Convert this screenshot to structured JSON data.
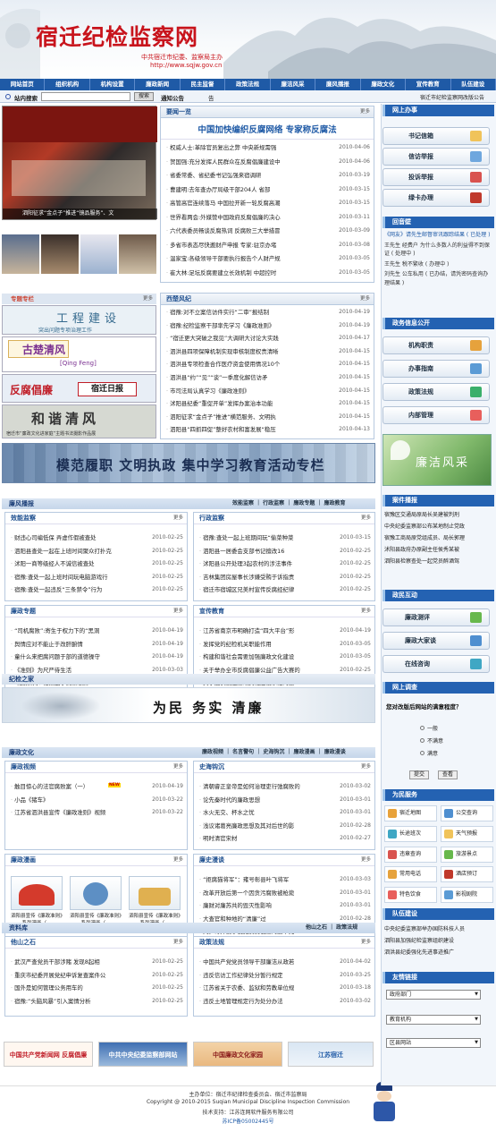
{
  "header": {
    "title": "宿迁纪检监察网",
    "subtitle": "中共宿迁市纪委、监察局主办",
    "url": "http://www.sqjw.gov.cn"
  },
  "nav": [
    "网站首页",
    "组织机构",
    "机构设置",
    "廉政新闻",
    "民主监督",
    "政策法规",
    "廉洁风采",
    "廉风播报",
    "廉政文化",
    "宣传教育",
    "队伍建设"
  ],
  "searchbar": {
    "label": "站内搜索",
    "button": "搜索",
    "notice_label": "通知公告",
    "notice_text": "告",
    "right_text": "宿迁市纪检监察网改版公告"
  },
  "photo_caption": "泗阳征求“金点子”推进“镜品服务”、文",
  "news": {
    "title": "要闻一览",
    "more": "更多",
    "headline": "中国加快编织反腐网络 专家称反腐法",
    "items": [
      [
        "权威人士:革除官员复出之弊 中央新规需强",
        "2010-04-06"
      ],
      [
        "贺国强:充分发挥人民群众在反腐倡廉建设中",
        "2010-04-06"
      ],
      [
        "省委常委、省纪委书记弘强来宿调研",
        "2010-03-19"
      ],
      [
        "曹建明:去年查办厅局级干部204人 省部",
        "2010-03-15"
      ],
      [
        "高管高官连续落马 中国拉开新一轮反腐高潮",
        "2010-03-15"
      ],
      [
        "世界看两会:外媒赞中国政府反腐倡廉的决心",
        "2010-03-11"
      ],
      [
        "六代表委员畅谈反腐热词 反腐败三大举措冒",
        "2010-03-09"
      ],
      [
        "多省市表态尽快邀财产申报 专家:驻京办堵",
        "2010-03-08"
      ],
      [
        "温家宝:各级领导干部要执行报告个人财产规",
        "2010-03-05"
      ],
      [
        "崔大林:足坛反腐要建立长效机制 中超控时",
        "2010-03-05"
      ]
    ]
  },
  "xichu": {
    "title": "西楚风纪",
    "more": "更多",
    "items": [
      [
        "宿豫:对不立案信访件实行“二审”报结制",
        "2010-04-19"
      ],
      [
        "宿豫:纪检监察干部率先学习《廉政准则》",
        "2010-04-19"
      ],
      [
        "“宿迁更大突破之我见”大调研大讨论大实践",
        "2010-04-17"
      ],
      [
        "泗洪县四项保障机制实现审核制度权责清晰",
        "2010-04-15"
      ],
      [
        "泗洪县专项检查合作医疗资金使用情况10个",
        "2010-04-15"
      ],
      [
        "泗洪县“约”“见”“谈”一季度化解信访矛",
        "2010-04-15"
      ],
      [
        "市司法局认真学习《廉政准则》",
        "2010-04-15"
      ],
      [
        "沭阳县纪委“重促开单”发挥办案治本功能",
        "2010-04-15"
      ],
      [
        "泗阳征求“金点子”推进“横范服务、文明执",
        "2010-04-15"
      ],
      [
        "泗阳县“四抓四促”整好农村和富发展“稳压",
        "2010-04-13"
      ]
    ]
  },
  "left_banners": {
    "mods_title": "专题专栏",
    "more": "更多",
    "b1": "工程建设",
    "b1s": "突出问题专项治理工作",
    "b2": "古楚清风",
    "b2s": "[Qing Feng]",
    "b3": "反腐倡廉",
    "b3s": "宿迁日报",
    "b4": "和谐清风",
    "b4s": "宿迁市“廉政文化进家庭”主题书法摄影作品展"
  },
  "wide_banner": "模范履职 文明执政 集中学习教育活动专栏",
  "lianfeng": {
    "title": "廉风播报",
    "tabs": "效能监察 ｜ 行政监察 ｜ 廉政专题 ｜ 廉政教育",
    "xiaoneng": {
      "title": "效能监察",
      "more": "更多",
      "items": [
        [
          "财违心司编低保 弄虚作假被查处",
          "2010-02-25"
        ],
        [
          "泗阳县查处一起在上班时间聚众打扑克",
          "2010-02-25"
        ],
        [
          "沭阳一商等级经人不诚信被查处",
          "2010-02-25"
        ],
        [
          "宿豫:查处一起上班时间玩电脑游戏行",
          "2010-02-25"
        ],
        [
          "宿豫:查处一起违反“三条禁令”行为",
          "2010-02-25"
        ]
      ]
    },
    "xingzheng": {
      "title": "行政监察",
      "more": "更多",
      "items": [
        [
          "宿豫:查处一起上班期间玩“偷菜种菜",
          "2010-03-15"
        ],
        [
          "泗阳县一居委会支部书记擅改16",
          "2010-02-25"
        ],
        [
          "沭阳县公开处理3起农村的涉法事件",
          "2010-02-25"
        ],
        [
          "吉林集团房屋事长涉嫌受贿于诉指责",
          "2010-02-25"
        ],
        [
          "宿迁市宿城区兄美村宣传反腐经纪律",
          "2010-02-25"
        ]
      ]
    },
    "lianzheng": {
      "title": "廉政专题",
      "more": "更多",
      "items": [
        [
          "“司机腐败”:寄生于权力下的“黑洞",
          "2010-04-19"
        ],
        [
          "舆情应对不能止于改肝腑情",
          "2010-04-19"
        ],
        [
          "童什么来把腐问题于部的道德操守",
          "2010-04-19"
        ],
        [
          "《准则》为尺严待生活",
          "2010-03-03"
        ],
        [
          "“红顾娟水”论捕盖了腐败根源",
          "2010-03-03"
        ]
      ]
    },
    "xuanchuan": {
      "title": "宣传教育",
      "more": "更多",
      "items": [
        [
          "江苏省南京市明确打造“四大平台”形",
          "2010-04-19"
        ],
        [
          "发挥党的纪检机关职能作用",
          "2010-03-05"
        ],
        [
          "构建和谐社会需要加强廉政文化建设",
          "2010-03-05"
        ],
        [
          "关于举办全市反腐倡廉公益广告大赛的",
          "2010-02-25"
        ],
        [
          "关于加快创建廉政文化建设示范的通",
          "2010-02-25"
        ]
      ]
    }
  },
  "jifeng": {
    "title": "纪检之家"
  },
  "slogan": "为民 务实 清廉",
  "wenhua": {
    "title": "廉政文化",
    "tabs": "廉政视频 ｜ 名言警句 ｜ 史海钩沉 ｜ 廉政漫画 ｜ 廉政漫谈",
    "video": {
      "title": "廉政视频",
      "more": "更多",
      "items": [
        [
          "触目惊心的法官腐败案（一）",
          "2010-04-19"
        ],
        [
          "小品《猪车》",
          "2010-03-22"
        ],
        [
          "江苏省泗洪县宣传《廉政准则》视频",
          "2010-03-22"
        ]
      ],
      "new": "NEW"
    },
    "shihai": {
      "title": "史海钩沉",
      "more": "更多",
      "items": [
        [
          "清朝睿正皇帝是如何治理吏行弛腐败的",
          "2010-03-02"
        ],
        [
          "论先秦时代的廉政思想",
          "2010-03-01"
        ],
        [
          "水火无交、杯水之忧",
          "2010-03-01"
        ],
        [
          "浅议诸葛亮廉政思想及其对后世的影",
          "2010-02-28"
        ],
        [
          "明时清官宋材",
          "2010-02-27"
        ]
      ]
    },
    "manhua": {
      "title": "廉政漫画",
      "more": "更多",
      "captions": [
        "泗阳县宣传《廉政准则》系列漫画（…",
        "泗阳县宣传《廉政准则》系列漫画（…",
        "泗阳县宣传《廉政准则》系列漫画（…"
      ]
    },
    "lishi": {
      "title": "廉史漫谈",
      "more": "更多",
      "items": [
        [
          "“拒腐猫将军”：雍号彰县叶飞将军",
          "2010-03-03"
        ],
        [
          "改革开放后第一个因贪污腐败被枪毙",
          "2010-03-01"
        ],
        [
          "廉财对廉苏共的毁灭性影响",
          "2010-03-01"
        ],
        [
          "大查官和种地的“清廉”过",
          "2010-02-28"
        ],
        [
          "刘少奇开创了我党反腐倡廉的最早先",
          "2010-02-27"
        ]
      ]
    }
  },
  "ziliao": {
    "title": "资料库",
    "tabs": "他山之石 ｜ 政策法规",
    "tashan": {
      "title": "他山之石",
      "more": "更多",
      "items": [
        [
          "武汉严查党员干部涉赌 发现8起相",
          "2010-02-25"
        ],
        [
          "重庆市纪委开展党纪申诉复查案件公",
          "2010-02-25"
        ],
        [
          "国外是如何管理公务用车的",
          "2010-02-25"
        ],
        [
          "宿豫:“头脑风暴”引入案情分析",
          "2010-02-25"
        ]
      ]
    },
    "fagui": {
      "title": "政策法规",
      "more": "更多",
      "items": [
        [
          "中国共产党党员领导干部廉洁从政若",
          "2010-04-02"
        ],
        [
          "违反信访工作纪律处分暂行规定",
          "2010-03-25"
        ],
        [
          "江苏省关于农委、监狱和劳教单位规",
          "2010-03-18"
        ],
        [
          "违反土地管理规定行为处分办法",
          "2010-03-02"
        ]
      ]
    }
  },
  "footer_logos": [
    "中国共产党新闻网 反腐倡廉",
    "中共中央纪委监察部网站",
    "中国廉政文化家园",
    "江苏宿迁"
  ],
  "footer": {
    "l1": "主办单位：宿迁市纪律检查委员会、宿迁市监察局",
    "l2": "Copyright @ 2010-2015 Suqian Municipal Discipline Inspection Commission",
    "l3": "技术支持：江苏连网软件服务有限公司",
    "l4": "苏ICP备05002445号"
  },
  "right": {
    "banshi": {
      "title": "网上办事",
      "buttons": [
        "书记信箱",
        "信访举报",
        "投诉举报",
        "绿卡办理"
      ]
    },
    "huiyin": {
      "title": "回音壁",
      "items": [
        "《网友》请先生邮督审讯跟踪结果 ( 已处理 )",
        "王先生 经费户 为什么多数人的利益得不到保证 ( 处理中 )",
        "王先生 税不繁收 ( 办理中 )",
        "刘先生 公车私用 ( 已办结，请凭密码查询办理结果 )"
      ]
    },
    "zhengwu": {
      "title": "政务信息公开",
      "buttons": [
        "机构职责",
        "办事指南",
        "政策法规",
        "内部管理"
      ]
    },
    "fengcai": "廉洁风采",
    "anjian": {
      "title": "案件播报",
      "items": [
        "宿豫区交通局原局长吴建被判刑",
        "中央纪委监察部公布某地制止党政",
        "宿豫工商局原党组成员、局长郭理",
        "沭阳县政府办原副主任侯秀某被",
        "泗阳县检察查处一起党员醉酒驾"
      ]
    },
    "hudong": {
      "title": "政民互动",
      "buttons": [
        "廉政测评",
        "廉政大家谈",
        "在线咨询"
      ]
    },
    "diaocha": {
      "title": "网上调查",
      "question": "您对改版后网站的满意程度？",
      "options": [
        "一般",
        "不满意",
        "满意"
      ],
      "submit": "提交",
      "view": "查看"
    },
    "fuwu": {
      "title": "为民服务",
      "items": [
        "宿迁地图",
        "公交查询",
        "长途班次",
        "天气预报",
        "违章查询",
        "旅游景点",
        "常用电话",
        "酒店预订",
        "特色饮食",
        "影视剧院"
      ]
    },
    "duiwu": {
      "title": "队伍建设",
      "items": [
        "中央纪委监察部举办国防科技人员",
        "泗阳县加强纪检监察组织建设",
        "泗洪县纪委强化先进事迹推广"
      ]
    },
    "links": {
      "title": "友情链接",
      "selects": [
        "政府部门",
        "教育机构",
        "区县网站"
      ]
    }
  }
}
